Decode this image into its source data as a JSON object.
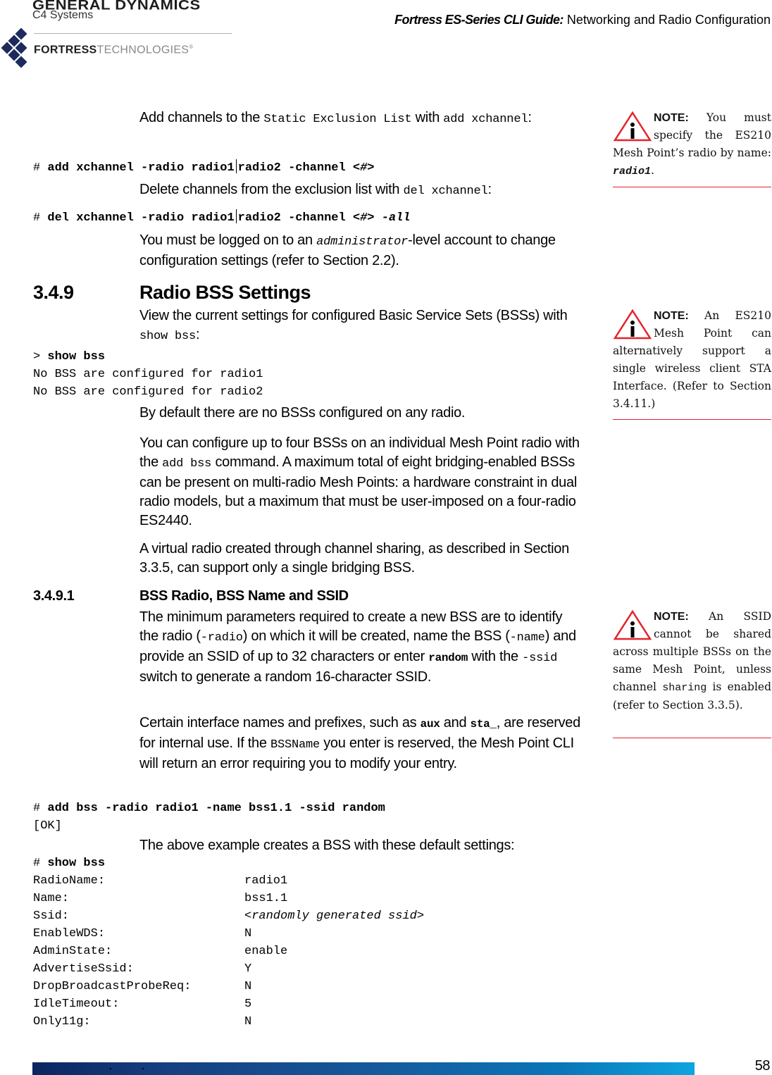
{
  "header": {
    "logo_gd": "GENERAL DYNAMICS",
    "logo_c4": "C4 Systems",
    "logo_fortress_bold": "FORTRESS",
    "logo_fortress_light": "TECHNOLOGIES",
    "logo_registered": "®",
    "guide_title_emphasis": "Fortress ES-Series CLI Guide:",
    "guide_title_rest": " Networking and Radio Configuration"
  },
  "body": {
    "p1": {
      "a": "Add channels to the ",
      "code1": "Static Exclusion List",
      "b": " with ",
      "code2": "add xchannel",
      "c": ":"
    },
    "cmd1": {
      "prompt": "# ",
      "a": "add xchannel -radio radio1",
      "b": "radio2 -channel ",
      "c": "<#>"
    },
    "p2": {
      "a": "Delete channels from the exclusion list with ",
      "code": "del xchannel",
      "b": ":"
    },
    "cmd2": {
      "prompt": "# ",
      "a": "del xchannel -radio radio1",
      "b": "radio2 -channel ",
      "c": "<#>",
      "d": " -all"
    },
    "p3": {
      "a": "You must be logged on to an ",
      "code": "administrator",
      "b": "-level account to change configuration settings (refer to Section 2.2)."
    },
    "section_349": {
      "number": "3.4.9",
      "title": "Radio BSS Settings"
    },
    "p4": {
      "a": "View the current settings for configured Basic Service Sets (BSSs) with ",
      "code": "show bss",
      "b": ":"
    },
    "cmd3": {
      "prompt": "> ",
      "command": "show bss",
      "out1": "No BSS are configured for radio1",
      "out2": "No BSS are configured for radio2"
    },
    "p5": "By default there are no BSSs configured on any radio.",
    "p6": {
      "a": "You can configure up to four BSSs on an individual Mesh Point radio with the ",
      "code": "add bss",
      "b": " command. A maximum total of eight bridging-enabled BSSs can be present on multi-radio Mesh Points: a hardware constraint in dual radio models, but a maximum that must be user-imposed on a four-radio ES2440."
    },
    "p7": "A virtual radio created through channel sharing, as described in Section 3.3.5, can support only a single bridging BSS.",
    "section_3491": {
      "number": "3.4.9.1",
      "title": "BSS Radio, BSS Name and SSID"
    },
    "p8": {
      "a": "The minimum parameters required to create a new BSS are to identify the radio (",
      "code1": "-radio",
      "b": ") on which it will be created, name the BSS (",
      "code2": "-name",
      "c": ") and provide an SSID of up to 32 characters or enter ",
      "code3": "random",
      "d": " with the ",
      "code4": "-ssid",
      "e": " switch to generate a random 16-character SSID."
    },
    "p9": {
      "a": "Certain interface names and prefixes, such as ",
      "code1": "aux",
      "b": " and ",
      "code2": "sta_",
      "c": ", are reserved for internal use. If the ",
      "code3": "BSSName",
      "d": " you enter is reserved, the Mesh Point CLI will return an error requiring you to modify your entry."
    },
    "cmd4": {
      "prompt": "# ",
      "command": "add bss -radio radio1 -name bss1.1 -ssid random",
      "out": "[OK]"
    },
    "p10": "The above example creates a BSS with these default settings:",
    "cmd5": {
      "prompt": "# ",
      "command": "show bss"
    },
    "bss_settings": [
      {
        "key": "RadioName:",
        "value": "radio1",
        "italic": false
      },
      {
        "key": "Name:",
        "value": "bss1.1",
        "italic": false
      },
      {
        "key": "Ssid:",
        "value": "<randomly generated ssid>",
        "italic": true
      },
      {
        "key": "EnableWDS:",
        "value": "N",
        "italic": false
      },
      {
        "key": "AdminState:",
        "value": "enable",
        "italic": false
      },
      {
        "key": "AdvertiseSsid:",
        "value": "Y",
        "italic": false
      },
      {
        "key": "DropBroadcastProbeReq:",
        "value": "N",
        "italic": false
      },
      {
        "key": "IdleTimeout:",
        "value": "5",
        "italic": false
      },
      {
        "key": "Only11g:",
        "value": "N",
        "italic": false
      }
    ]
  },
  "notes": [
    {
      "label": "NOTE:",
      "text_a": " You must specify the ES210 Mesh Point’s radio by name: ",
      "code": "radio1",
      "text_b": "."
    },
    {
      "label": "NOTE:",
      "text_a": " An ES210 Mesh Point can alternatively support a single wireless client STA Interface. (Refer to Section 3.4.11.)"
    },
    {
      "label": "NOTE:",
      "text_a": " An SSID cannot be shared across multiple BSSs on the same Mesh Point, unless channel ",
      "code": "sharing",
      "text_b": " is enabled (refer to Section 3.3.5)."
    }
  ],
  "footer": {
    "page_number": "58"
  },
  "colors": {
    "note_rule": "#e3242b",
    "warning_triangle": "#e3242b",
    "logo_navy": "#1c2a5e",
    "footer_start": "#0b2660",
    "footer_end": "#0ea5e0"
  }
}
